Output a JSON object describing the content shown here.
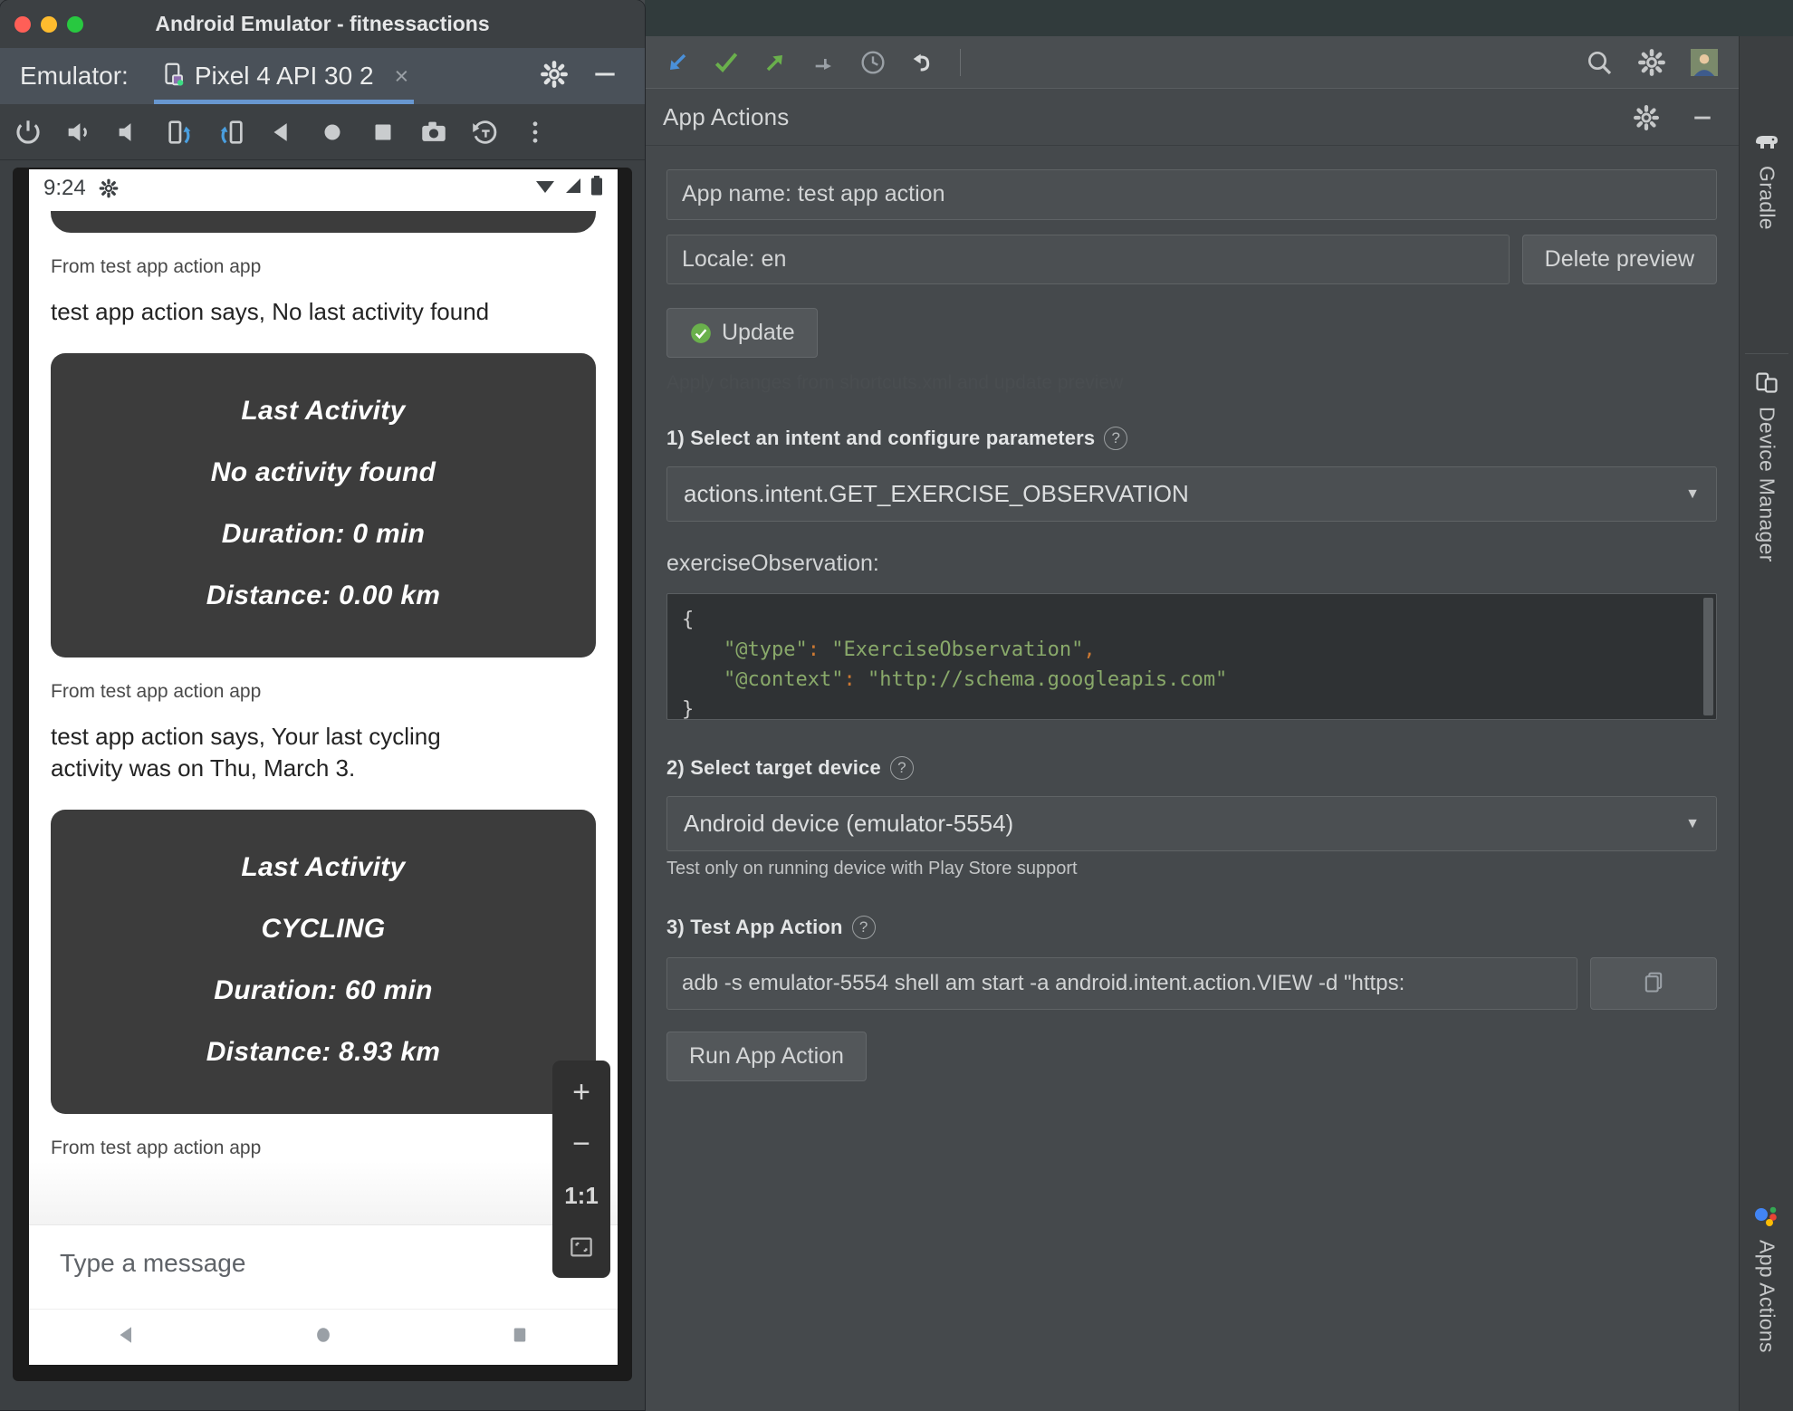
{
  "emulator": {
    "window_title": "Android Emulator - fitnessactions",
    "label": "Emulator:",
    "tab_name": "Pixel 4 API 30 2",
    "tab_close": "×",
    "toolbar_icons": [
      "power-icon",
      "volume-up-icon",
      "volume-down-icon",
      "rotate-left-icon",
      "rotate-right-icon",
      "back-icon",
      "home-icon",
      "overview-icon",
      "screenshot-icon",
      "record-icon",
      "more-icon"
    ],
    "window_buttons": [
      "settings-gear-icon",
      "minimize-icon"
    ],
    "traffic_lights": [
      "close",
      "minimize",
      "zoom"
    ]
  },
  "phone": {
    "status_time": "9:24",
    "status_icons": [
      "gear-icon",
      "wifi-icon",
      "signal-icon",
      "battery-icon"
    ],
    "messages": [
      {
        "from": "From test app action app",
        "says": "test app action says, No last activity found",
        "card": {
          "title": "Last Activity",
          "activity": "No activity found",
          "duration": "Duration: 0 min",
          "distance": "Distance: 0.00 km"
        }
      },
      {
        "from": "From test app action app",
        "says": "test app action says, Your last cycling activity was on Thu, March 3.",
        "card": {
          "title": "Last Activity",
          "activity": "CYCLING",
          "duration": "Duration: 60 min",
          "distance": "Distance: 8.93 km"
        }
      }
    ],
    "trailing_from": "From test app action app",
    "input_placeholder": "Type a message",
    "nav_icons": [
      "back-triangle-icon",
      "home-circle-icon",
      "recents-square-icon"
    ],
    "zoom_controls": {
      "zoom_in": "+",
      "zoom_out": "−",
      "actual_size": "1:1",
      "fit_to_screen": "fit-screen-icon"
    }
  },
  "ide_toolbar": {
    "icons": [
      "step-into-icon",
      "run-check-icon",
      "step-out-icon",
      "step-over-icon",
      "clock-history-icon",
      "undo-icon"
    ],
    "right_icons": [
      "search-icon",
      "settings-gear-icon",
      "avatar-icon"
    ]
  },
  "app_actions": {
    "panel_title": "App Actions",
    "header_icons": [
      "settings-gear-icon",
      "minimize-icon"
    ],
    "app_name_field": "App name: test app action",
    "locale_field": "Locale: en",
    "delete_preview_button": "Delete preview",
    "update_button": "Update",
    "update_hint": "Apply changes from shortcuts.xml and update preview",
    "step1_label": "1) Select an intent and configure parameters",
    "intent_value": "actions.intent.GET_EXERCISE_OBSERVATION",
    "param_label": "exerciseObservation:",
    "json_code": {
      "line1": "{",
      "line2_key": "\"@type\"",
      "line2_val": "\"ExerciseObservation\"",
      "line3_key": "\"@context\"",
      "line3_val": "\"http://schema.googleapis.com\"",
      "line4": "}"
    },
    "step2_label": "2) Select target device",
    "device_value": "Android device (emulator-5554)",
    "device_note": "Test only on running device with Play Store support",
    "step3_label": "3) Test App Action",
    "adb_command": "adb -s emulator-5554 shell am start -a android.intent.action.VIEW -d \"https:",
    "copy_button_icon": "copy-icon",
    "run_button": "Run App Action"
  },
  "tool_strip": {
    "items": [
      {
        "label": "Gradle",
        "icon": "gradle-elephant-icon"
      },
      {
        "label": "Device Manager",
        "icon": "device-manager-icon"
      },
      {
        "label": "App Actions",
        "icon": "assistant-dots-icon"
      }
    ]
  },
  "colors": {
    "accent_blue": "#6897d0",
    "green_check": "#6ab04c",
    "panel_bg": "#45494c",
    "code_bg": "#2f3234",
    "string_green": "#89a96a"
  }
}
